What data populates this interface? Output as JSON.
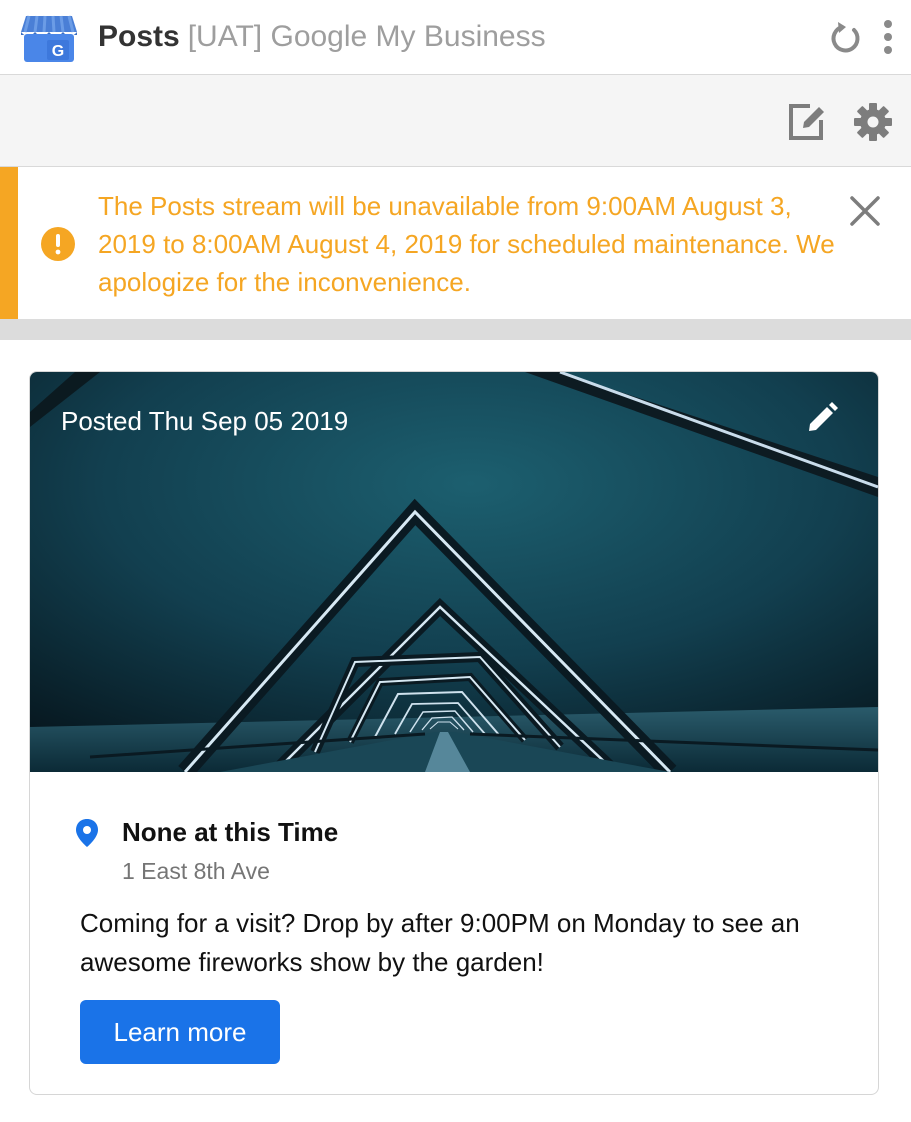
{
  "header": {
    "title": "Posts",
    "subtitle": "[UAT] Google My Business",
    "logo_icon": "google-my-business-logo",
    "refresh_icon": "refresh-icon",
    "more_icon": "more-vertical-icon"
  },
  "toolbar": {
    "compose_icon": "compose-icon",
    "settings_icon": "gear-icon"
  },
  "alert": {
    "message": "The Posts stream will be unavailable from 9:00AM August 3, 2019 to 8:00AM August 4, 2019 for scheduled maintenance. We apologize for the inconvenience.",
    "icon": "warning-icon",
    "close_icon": "close-icon",
    "color": "#f5a623"
  },
  "post": {
    "posted_label": "Posted Thu Sep 05 2019",
    "edit_icon": "pencil-icon",
    "location_name": "None at this Time",
    "location_address": "1 East 8th Ave",
    "body": "Coming for a visit? Drop by after 9:00PM on Monday to see an awesome fireworks show by the garden!",
    "cta_label": "Learn more",
    "cta_color": "#1a73e8",
    "pin_color": "#1a73e8"
  }
}
